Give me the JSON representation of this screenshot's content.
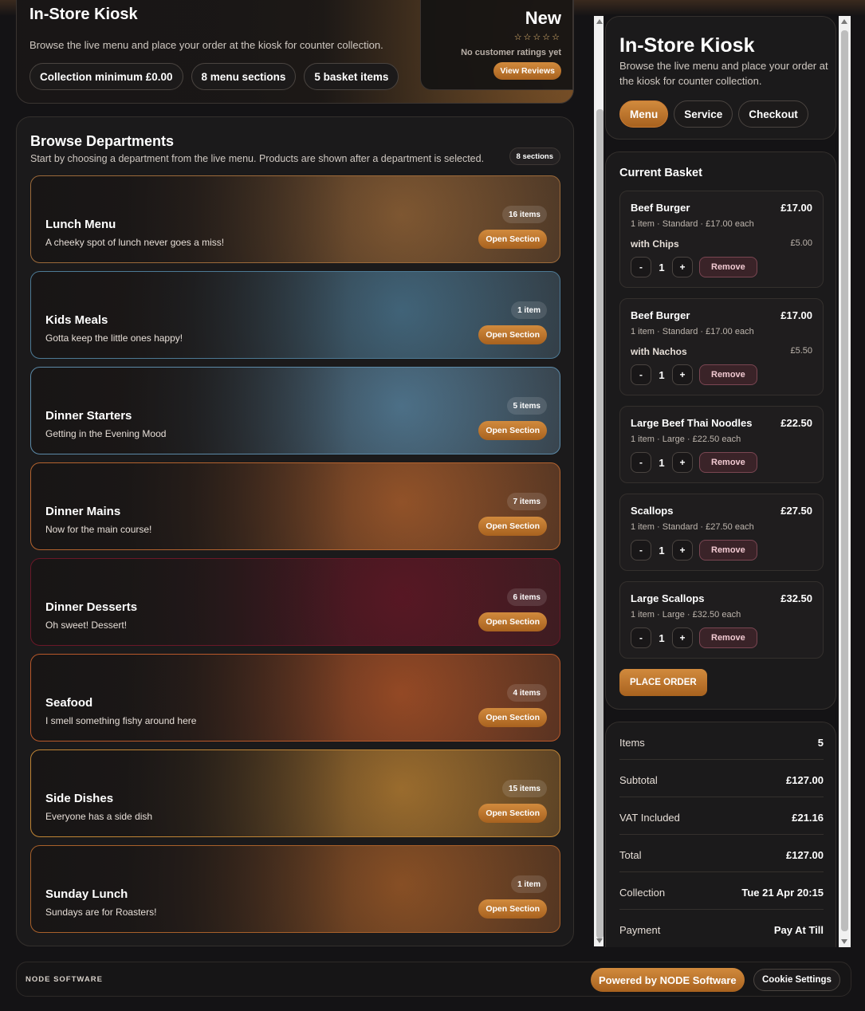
{
  "hero": {
    "title": "In-Store Kiosk",
    "subtitle": "Browse the live menu and place your order at the kiosk for counter collection.",
    "chips": [
      "Collection minimum £0.00",
      "8 menu sections",
      "5 basket items"
    ],
    "rating_label": "New",
    "stars": "☆☆☆☆☆",
    "no_ratings": "No customer ratings yet",
    "view_reviews": "View Reviews"
  },
  "departments": {
    "title": "Browse Departments",
    "subtitle": "Start by choosing a department from the live menu. Products are shown after a department is selected.",
    "count_badge": "8 sections",
    "open_label": "Open Section",
    "items": [
      {
        "name": "Lunch Menu",
        "desc": "A cheeky spot of lunch never goes a miss!",
        "count": "16 items",
        "color": "#9c6a3a"
      },
      {
        "name": "Kids Meals",
        "desc": "Gotta keep the little ones happy!",
        "count": "1 item",
        "color": "#4d7a95"
      },
      {
        "name": "Dinner Starters",
        "desc": "Getting in the Evening Mood",
        "count": "5 items",
        "color": "#5c8aa8"
      },
      {
        "name": "Dinner Mains",
        "desc": "Now for the main course!",
        "count": "7 items",
        "color": "#b5642f"
      },
      {
        "name": "Dinner Desserts",
        "desc": "Oh sweet! Dessert!",
        "count": "6 items",
        "color": "#6a1828"
      },
      {
        "name": "Seafood",
        "desc": "I smell something fishy around here",
        "count": "4 items",
        "color": "#b8582a"
      },
      {
        "name": "Side Dishes",
        "desc": "Everyone has a side dish",
        "count": "15 items",
        "color": "#c08535"
      },
      {
        "name": "Sunday Lunch",
        "desc": "Sundays are for Roasters!",
        "count": "1 item",
        "color": "#a8602a"
      }
    ]
  },
  "kiosk": {
    "title": "In-Store Kiosk",
    "subtitle": "Browse the live menu and place your order at the kiosk for counter collection.",
    "tabs": [
      "Menu",
      "Service",
      "Checkout"
    ]
  },
  "basket": {
    "title": "Current Basket",
    "remove_label": "Remove",
    "minus": "-",
    "plus": "+",
    "items": [
      {
        "name": "Beef Burger",
        "price": "£17.00",
        "meta": "1 item · Standard · £17.00 each",
        "extra": "with Chips",
        "extra_price": "£5.00",
        "qty": "1"
      },
      {
        "name": "Beef Burger",
        "price": "£17.00",
        "meta": "1 item · Standard · £17.00 each",
        "extra": "with Nachos",
        "extra_price": "£5.50",
        "qty": "1"
      },
      {
        "name": "Large Beef Thai Noodles",
        "price": "£22.50",
        "meta": "1 item · Large · £22.50 each",
        "qty": "1"
      },
      {
        "name": "Scallops",
        "price": "£27.50",
        "meta": "1 item · Standard · £27.50 each",
        "qty": "1"
      },
      {
        "name": "Large Scallops",
        "price": "£32.50",
        "meta": "1 item · Large · £32.50 each",
        "qty": "1"
      }
    ],
    "place_order": "PLACE ORDER"
  },
  "summary": [
    {
      "label": "Items",
      "value": "5"
    },
    {
      "label": "Subtotal",
      "value": "£127.00"
    },
    {
      "label": "VAT Included",
      "value": "£21.16"
    },
    {
      "label": "Total",
      "value": "£127.00"
    },
    {
      "label": "Collection",
      "value": "Tue 21 Apr 20:15"
    },
    {
      "label": "Payment",
      "value": "Pay At Till"
    }
  ],
  "footer": {
    "brand": "NODE SOFTWARE",
    "powered": "Powered by NODE Software",
    "cookie": "Cookie Settings"
  }
}
